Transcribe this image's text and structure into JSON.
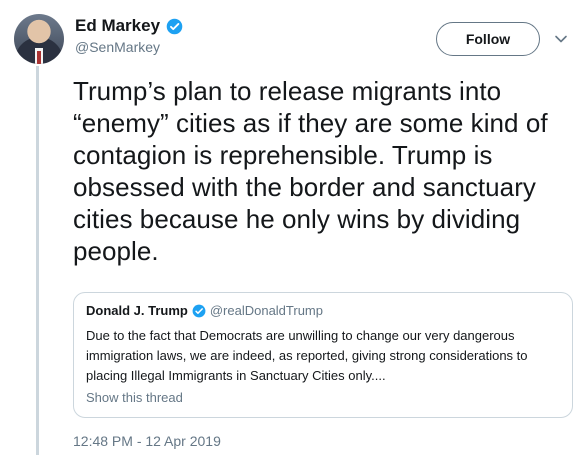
{
  "author": {
    "name": "Ed Markey",
    "handle": "@SenMarkey",
    "verified_icon": "verified-badge-icon"
  },
  "follow_label": "Follow",
  "tweet": {
    "lines": [
      "Trump’s plan to release migrants into",
      "“enemy” cities as if they are some kind of",
      "contagion is reprehensible. Trump is",
      "obsessed with the border and sanctuary",
      "cities because he only wins by dividing",
      "people."
    ]
  },
  "quoted": {
    "name": "Donald J. Trump",
    "handle": "@realDonaldTrump",
    "lines": [
      "Due to the fact that Democrats are unwilling to change our very dangerous",
      "immigration laws, we are indeed, as reported, giving strong considerations to",
      "placing Illegal Immigrants in Sanctuary Cities only...."
    ],
    "show_thread": "Show this thread"
  },
  "timestamp": "12:48 PM - 12 Apr 2019",
  "colors": {
    "verified": "#1da1f2",
    "secondary_text": "#657786",
    "border": "#ccd6dd"
  }
}
